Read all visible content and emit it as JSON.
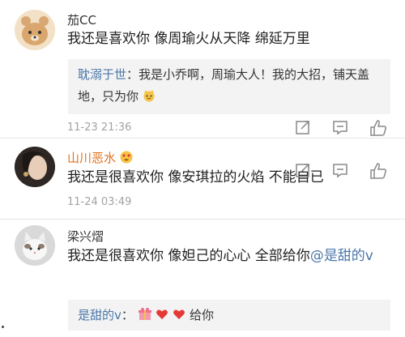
{
  "comments": [
    {
      "user": "茄CC",
      "text": "我还是喜欢你  像周瑜火从天降  绵延万里",
      "reply": {
        "user": "耽溺于世",
        "text": "：我是小乔啊，周瑜大人！我的大招，铺天盖地，只为你"
      },
      "time": "11-23 21:36"
    },
    {
      "user": "山川恶水",
      "text": "我还是很喜欢你  像安琪拉的火焰  不能自已",
      "time": "11-24 03:49"
    },
    {
      "user": "梁兴熠",
      "text": "我还是很喜欢你  像妲己的心心  全部给你",
      "mention": "@是甜的v",
      "reply": {
        "user": "是甜的v",
        "text": "：",
        "tail": "给你"
      }
    }
  ],
  "icons": [
    "share-icon",
    "comment-icon",
    "like-icon"
  ],
  "colors": {
    "link": "#4a76a8",
    "orange_name": "#e0731f",
    "time": "#a3a3a3",
    "reply_bg": "#f3f3f3"
  }
}
